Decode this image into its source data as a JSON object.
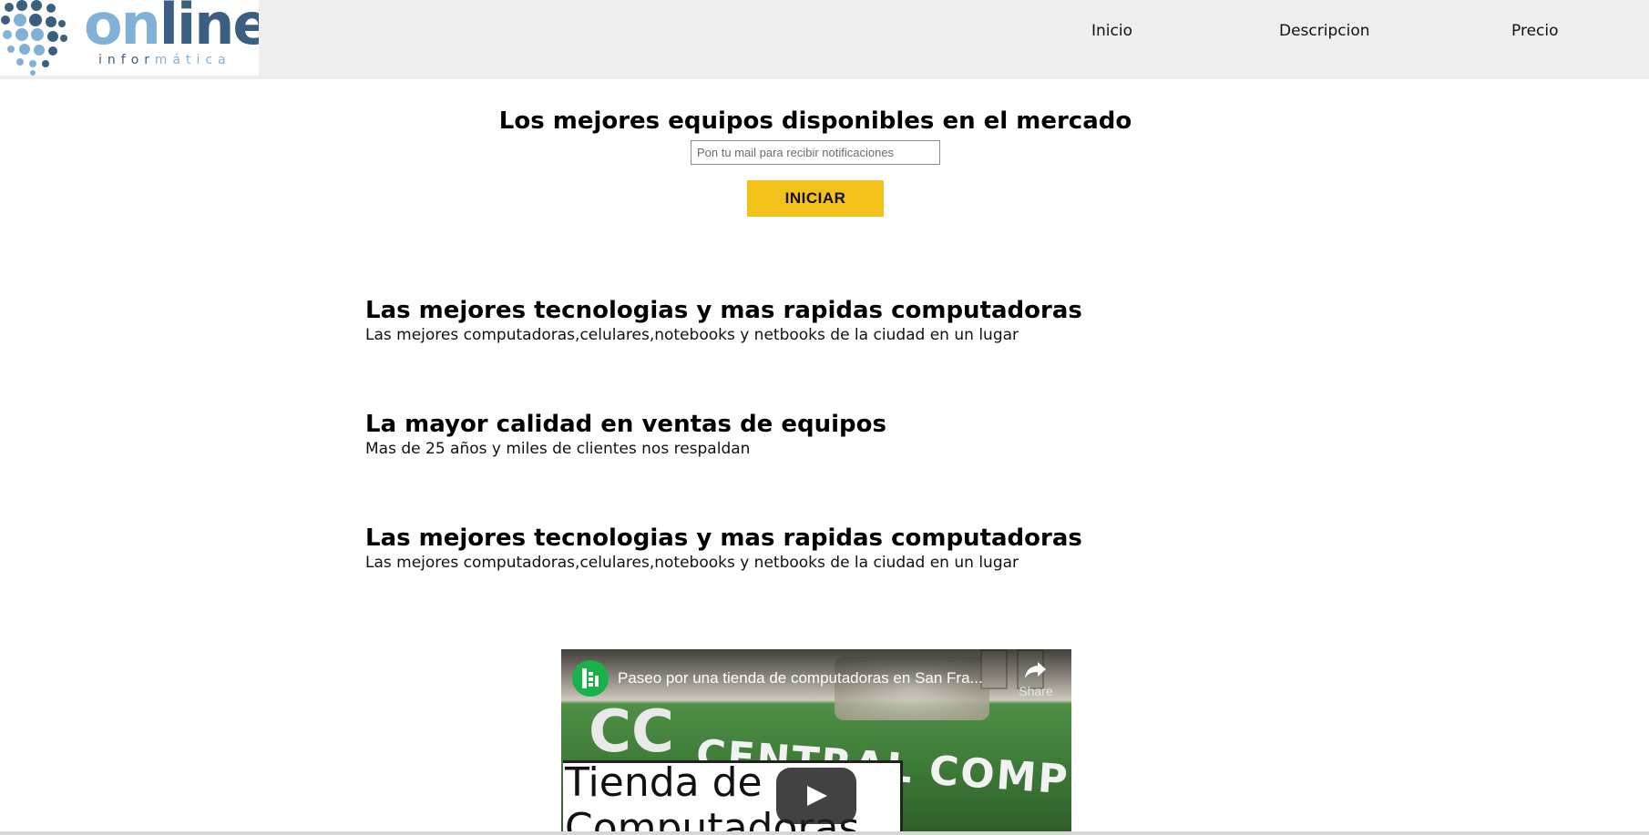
{
  "brand": {
    "logo_word_part1": "on",
    "logo_word_part2": "line",
    "logo_sub_part1": "infor",
    "logo_sub_part2": "mática",
    "colors": {
      "light_blue": "#7fb2d6",
      "dark_blue": "#3a5f80"
    }
  },
  "nav": {
    "items": [
      {
        "label": "Inicio"
      },
      {
        "label": "Descripcion"
      },
      {
        "label": "Precio"
      }
    ]
  },
  "hero": {
    "title": "Los mejores equipos disponibles en el mercado",
    "email_placeholder": "Pon tu mail para recibir notificaciones",
    "email_value": "",
    "button_label": "INICIAR",
    "button_color": "#f2c21b"
  },
  "features": [
    {
      "title": "Las mejores tecnologias y mas rapidas computadoras",
      "text": "Las mejores computadoras,celulares,notebooks y netbooks de la ciudad en un lugar"
    },
    {
      "title": "La mayor calidad en ventas de equipos",
      "text": "Mas de 25 años y miles de clientes nos respaldan"
    },
    {
      "title": "Las mejores tecnologias y mas rapidas computadoras",
      "text": "Las mejores computadoras,celulares,notebooks y netbooks de la ciudad en un lugar"
    }
  ],
  "video": {
    "title": "Paseo por una tienda de computadoras en San Fra...",
    "share_label": "Share",
    "caption_line1": "Tienda de",
    "caption_line2": "Computadoras",
    "sign_text": "CENTRAL COMPUTERS",
    "cc_text": "CC",
    "channel_icon": "channel-logo-icon"
  }
}
